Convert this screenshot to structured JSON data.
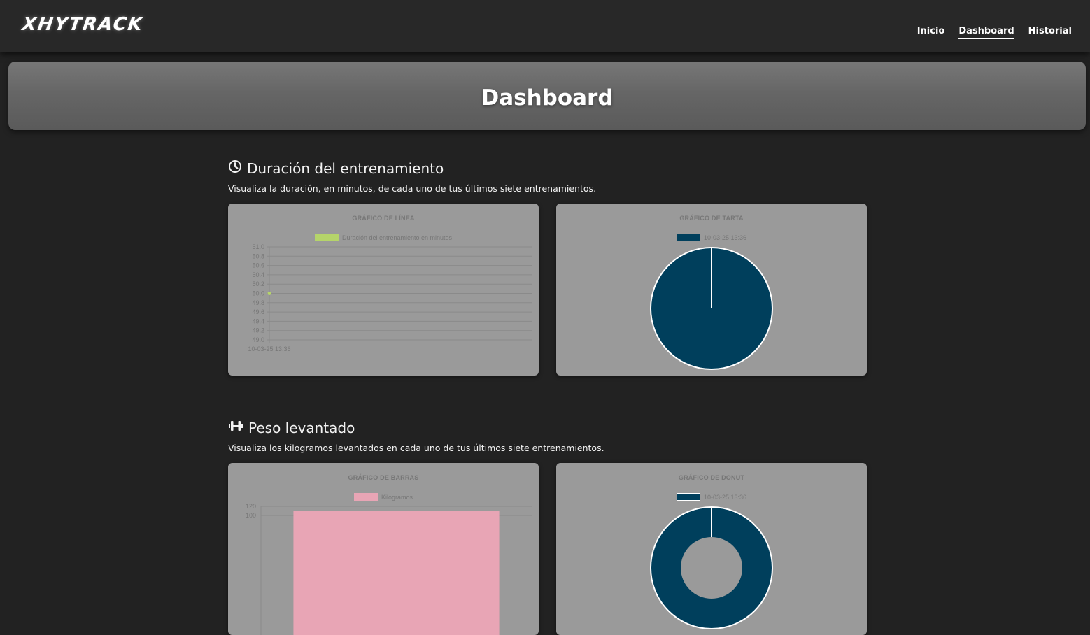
{
  "header": {
    "logo": "XHYTRACK",
    "nav": [
      "Inicio",
      "Dashboard",
      "Historial"
    ]
  },
  "hero": {
    "title": "Dashboard"
  },
  "sections": [
    {
      "icon": "clock-icon",
      "title": "Duración del entrenamiento",
      "description": "Visualiza la duración, en minutos, de cada uno de tus últimos siete entrenamientos."
    },
    {
      "icon": "dumbbell-icon",
      "title": "Peso levantado",
      "description": "Visualiza los kilogramos levantados en cada uno de tus últimos siete entrenamientos."
    }
  ],
  "colors": {
    "line_series": "#b5d46a",
    "pie_slice": "#003f5c",
    "bar_series": "#e8a5b5",
    "card_bg": "#9a9a9a"
  },
  "chart_data": [
    {
      "type": "line",
      "title": "GRÁFICO DE LÍNEA",
      "categories": [
        "10-03-25 13:36"
      ],
      "series": [
        {
          "name": "Duración del entrenamiento en minutos",
          "values": [
            50
          ]
        }
      ],
      "yticks": [
        "51.0",
        "50.8",
        "50.6",
        "50.4",
        "50.2",
        "50.0",
        "49.8",
        "49.6",
        "49.4",
        "49.2",
        "49.0"
      ],
      "ylim": [
        49.0,
        51.0
      ],
      "legend": "top",
      "grid": true
    },
    {
      "type": "pie",
      "title": "GRÁFICO DE TARTA",
      "categories": [
        "10-03-25 13:36"
      ],
      "values": [
        50
      ],
      "legend": "top"
    },
    {
      "type": "bar",
      "title": "GRÁFICO DE BARRAS",
      "categories": [
        "10-03-25 13:36"
      ],
      "series": [
        {
          "name": "Kilogramos",
          "values": [
            110
          ]
        }
      ],
      "yticks": [
        "120",
        "100"
      ],
      "ylim": [
        0,
        120
      ],
      "legend": "top",
      "grid": true
    },
    {
      "type": "pie",
      "title": "GRÁFICO DE DONUT",
      "categories": [
        "10-03-25 13:36"
      ],
      "values": [
        110
      ],
      "legend": "top"
    }
  ]
}
